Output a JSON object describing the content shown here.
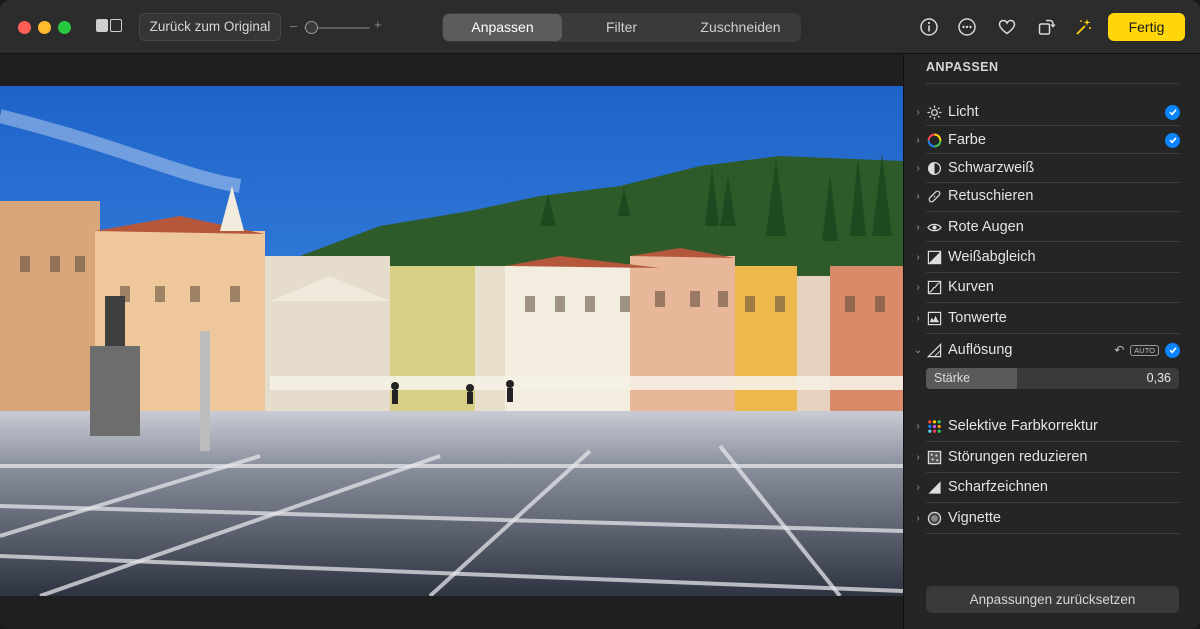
{
  "toolbar": {
    "revert_label": "Zurück zum Original",
    "zoom_minus": "–",
    "zoom_plus": "+",
    "zoom_level": 0.05,
    "tabs": [
      {
        "label": "Anpassen",
        "active": true
      },
      {
        "label": "Filter",
        "active": false
      },
      {
        "label": "Zuschneiden",
        "active": false
      }
    ],
    "icons": [
      "info-icon",
      "more-icon",
      "favorite-heart-icon",
      "rotate-icon",
      "auto-enhance-wand-icon"
    ],
    "done_label": "Fertig",
    "accent_color": "#ffd60a"
  },
  "sidebar": {
    "title": "ANPASSEN",
    "items": [
      {
        "label": "Licht",
        "icon": "sun-icon",
        "checked": true,
        "expanded": false
      },
      {
        "label": "Farbe",
        "icon": "color-wheel-icon",
        "checked": true,
        "expanded": false
      },
      {
        "label": "Schwarzweiß",
        "icon": "half-circle-icon",
        "checked": false,
        "expanded": false
      },
      {
        "label": "Retuschieren",
        "icon": "bandage-icon",
        "checked": false,
        "expanded": false
      },
      {
        "label": "Rote Augen",
        "icon": "eye-icon",
        "checked": false,
        "expanded": false
      },
      {
        "label": "Weißabgleich",
        "icon": "white-balance-icon",
        "checked": false,
        "expanded": false
      },
      {
        "label": "Kurven",
        "icon": "curves-icon",
        "checked": false,
        "expanded": false
      },
      {
        "label": "Tonwerte",
        "icon": "levels-icon",
        "checked": false,
        "expanded": false
      },
      {
        "label": "Auflösung",
        "icon": "definition-icon",
        "checked": true,
        "expanded": true,
        "auto_badge": "AUTO"
      },
      {
        "label": "Selektive Farbkorrektur",
        "icon": "dots-color-icon",
        "checked": false,
        "expanded": false
      },
      {
        "label": "Störungen reduzieren",
        "icon": "noise-icon",
        "checked": false,
        "expanded": false
      },
      {
        "label": "Scharfzeichnen",
        "icon": "sharpen-triangle-icon",
        "checked": false,
        "expanded": false
      },
      {
        "label": "Vignette",
        "icon": "vignette-icon",
        "checked": false,
        "expanded": false
      }
    ],
    "slider": {
      "label": "Stärke",
      "value": "0,36",
      "fraction": 0.36
    },
    "reset_label": "Anpassungen zurücksetzen",
    "check_color": "#0a84ff"
  }
}
